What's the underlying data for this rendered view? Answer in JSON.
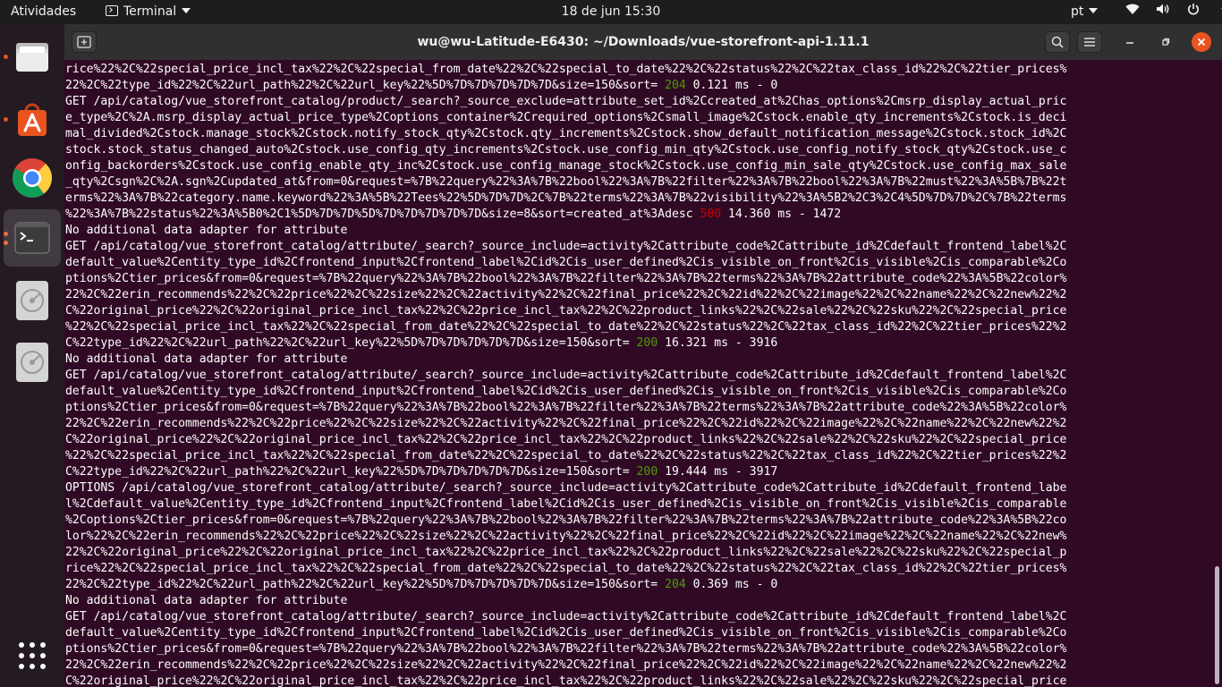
{
  "topbar": {
    "activities": "Atividades",
    "app_name": "Terminal",
    "clock": "18 de jun  15:30",
    "lang": "pt",
    "icons": [
      "wifi-icon",
      "volume-icon",
      "power-icon"
    ]
  },
  "dock": {
    "apps": [
      {
        "name": "files",
        "icon": "folder-icon",
        "running": true
      },
      {
        "name": "software",
        "icon": "shopping-bag-icon",
        "running": true
      },
      {
        "name": "chrome",
        "icon": "chrome-icon",
        "running": false
      },
      {
        "name": "terminal",
        "icon": "terminal-icon",
        "running": true,
        "active": true
      },
      {
        "name": "disc-1",
        "icon": "disc-icon",
        "running": false
      },
      {
        "name": "disc-2",
        "icon": "disc-icon",
        "running": false
      }
    ],
    "show_apps_icon": "grid-icon",
    "colors": {
      "accent": "#e95420"
    }
  },
  "window": {
    "title": "wu@wu-Latitude-E6430: ~/Downloads/vue-storefront-api-1.11.1"
  },
  "terminal": {
    "colors": {
      "bg": "#300a24",
      "fg": "#ffffff",
      "ok": "#4e9a06",
      "err": "#cc0000"
    },
    "lines": [
      {
        "t": "rice%22%2C%22special_price_incl_tax%22%2C%22special_from_date%22%2C%22special_to_date%22%2C%22status%22%2C%22tax_class_id%22%2C%22tier_prices%"
      },
      {
        "t": "22%2C%22type_id%22%2C%22url_path%22%2C%22url_key%22%5D%7D%7D%7D%7D%7D&size=150&sort= ",
        "s": "204",
        "c": "g",
        "r": " 0.121 ms - 0"
      },
      {
        "t": "GET /api/catalog/vue_storefront_catalog/product/_search?_source_exclude=attribute_set_id%2Ccreated_at%2Chas_options%2Cmsrp_display_actual_pric"
      },
      {
        "t": "e_type%2C%2A.msrp_display_actual_price_type%2Coptions_container%2Crequired_options%2Csmall_image%2Cstock.enable_qty_increments%2Cstock.is_deci"
      },
      {
        "t": "mal_divided%2Cstock.manage_stock%2Cstock.notify_stock_qty%2Cstock.qty_increments%2Cstock.show_default_notification_message%2Cstock.stock_id%2C"
      },
      {
        "t": "stock.stock_status_changed_auto%2Cstock.use_config_qty_increments%2Cstock.use_config_min_qty%2Cstock.use_config_notify_stock_qty%2Cstock.use_c"
      },
      {
        "t": "onfig_backorders%2Cstock.use_config_enable_qty_inc%2Cstock.use_config_manage_stock%2Cstock.use_config_min_sale_qty%2Cstock.use_config_max_sale"
      },
      {
        "t": "_qty%2Csgn%2C%2A.sgn%2Cupdated_at&from=0&request=%7B%22query%22%3A%7B%22bool%22%3A%7B%22filter%22%3A%7B%22bool%22%3A%7B%22must%22%3A%5B%7B%22t"
      },
      {
        "t": "erms%22%3A%7B%22category.name.keyword%22%3A%5B%22Tees%22%5D%7D%7D%2C%7B%22terms%22%3A%7B%22visibility%22%3A%5B2%2C3%2C4%5D%7D%7D%2C%7B%22terms"
      },
      {
        "t": "%22%3A%7B%22status%22%3A%5B0%2C1%5D%7D%7D%5D%7D%7D%7D%7D%7D&size=8&sort=created_at%3Adesc ",
        "s": "500",
        "c": "r",
        "r": " 14.360 ms - 1472"
      },
      {
        "t": "No additional data adapter for attribute"
      },
      {
        "t": "GET /api/catalog/vue_storefront_catalog/attribute/_search?_source_include=activity%2Cattribute_code%2Cattribute_id%2Cdefault_frontend_label%2C"
      },
      {
        "t": "default_value%2Centity_type_id%2Cfrontend_input%2Cfrontend_label%2Cid%2Cis_user_defined%2Cis_visible_on_front%2Cis_visible%2Cis_comparable%2Co"
      },
      {
        "t": "ptions%2Ctier_prices&from=0&request=%7B%22query%22%3A%7B%22bool%22%3A%7B%22filter%22%3A%7B%22terms%22%3A%7B%22attribute_code%22%3A%5B%22color%"
      },
      {
        "t": "22%2C%22erin_recommends%22%2C%22price%22%2C%22size%22%2C%22activity%22%2C%22final_price%22%2C%22id%22%2C%22image%22%2C%22name%22%2C%22new%22%2"
      },
      {
        "t": "C%22original_price%22%2C%22original_price_incl_tax%22%2C%22price_incl_tax%22%2C%22product_links%22%2C%22sale%22%2C%22sku%22%2C%22special_price"
      },
      {
        "t": "%22%2C%22special_price_incl_tax%22%2C%22special_from_date%22%2C%22special_to_date%22%2C%22status%22%2C%22tax_class_id%22%2C%22tier_prices%22%2"
      },
      {
        "t": "C%22type_id%22%2C%22url_path%22%2C%22url_key%22%5D%7D%7D%7D%7D%7D&size=150&sort= ",
        "s": "200",
        "c": "g",
        "r": " 16.321 ms - 3916"
      },
      {
        "t": "No additional data adapter for attribute"
      },
      {
        "t": "GET /api/catalog/vue_storefront_catalog/attribute/_search?_source_include=activity%2Cattribute_code%2Cattribute_id%2Cdefault_frontend_label%2C"
      },
      {
        "t": "default_value%2Centity_type_id%2Cfrontend_input%2Cfrontend_label%2Cid%2Cis_user_defined%2Cis_visible_on_front%2Cis_visible%2Cis_comparable%2Co"
      },
      {
        "t": "ptions%2Ctier_prices&from=0&request=%7B%22query%22%3A%7B%22bool%22%3A%7B%22filter%22%3A%7B%22terms%22%3A%7B%22attribute_code%22%3A%5B%22color%"
      },
      {
        "t": "22%2C%22erin_recommends%22%2C%22price%22%2C%22size%22%2C%22activity%22%2C%22final_price%22%2C%22id%22%2C%22image%22%2C%22name%22%2C%22new%22%2"
      },
      {
        "t": "C%22original_price%22%2C%22original_price_incl_tax%22%2C%22price_incl_tax%22%2C%22product_links%22%2C%22sale%22%2C%22sku%22%2C%22special_price"
      },
      {
        "t": "%22%2C%22special_price_incl_tax%22%2C%22special_from_date%22%2C%22special_to_date%22%2C%22status%22%2C%22tax_class_id%22%2C%22tier_prices%22%2"
      },
      {
        "t": "C%22type_id%22%2C%22url_path%22%2C%22url_key%22%5D%7D%7D%7D%7D%7D&size=150&sort= ",
        "s": "200",
        "c": "g",
        "r": " 19.444 ms - 3917"
      },
      {
        "t": "OPTIONS /api/catalog/vue_storefront_catalog/attribute/_search?_source_include=activity%2Cattribute_code%2Cattribute_id%2Cdefault_frontend_labe"
      },
      {
        "t": "l%2Cdefault_value%2Centity_type_id%2Cfrontend_input%2Cfrontend_label%2Cid%2Cis_user_defined%2Cis_visible_on_front%2Cis_visible%2Cis_comparable"
      },
      {
        "t": "%2Coptions%2Ctier_prices&from=0&request=%7B%22query%22%3A%7B%22bool%22%3A%7B%22filter%22%3A%7B%22terms%22%3A%7B%22attribute_code%22%3A%5B%22co"
      },
      {
        "t": "lor%22%2C%22erin_recommends%22%2C%22price%22%2C%22size%22%2C%22activity%22%2C%22final_price%22%2C%22id%22%2C%22image%22%2C%22name%22%2C%22new%"
      },
      {
        "t": "22%2C%22original_price%22%2C%22original_price_incl_tax%22%2C%22price_incl_tax%22%2C%22product_links%22%2C%22sale%22%2C%22sku%22%2C%22special_p"
      },
      {
        "t": "rice%22%2C%22special_price_incl_tax%22%2C%22special_from_date%22%2C%22special_to_date%22%2C%22status%22%2C%22tax_class_id%22%2C%22tier_prices%"
      },
      {
        "t": "22%2C%22type_id%22%2C%22url_path%22%2C%22url_key%22%5D%7D%7D%7D%7D%7D&size=150&sort= ",
        "s": "204",
        "c": "g",
        "r": " 0.369 ms - 0"
      },
      {
        "t": "No additional data adapter for attribute"
      },
      {
        "t": "GET /api/catalog/vue_storefront_catalog/attribute/_search?_source_include=activity%2Cattribute_code%2Cattribute_id%2Cdefault_frontend_label%2C"
      },
      {
        "t": "default_value%2Centity_type_id%2Cfrontend_input%2Cfrontend_label%2Cid%2Cis_user_defined%2Cis_visible_on_front%2Cis_visible%2Cis_comparable%2Co"
      },
      {
        "t": "ptions%2Ctier_prices&from=0&request=%7B%22query%22%3A%7B%22bool%22%3A%7B%22filter%22%3A%7B%22terms%22%3A%7B%22attribute_code%22%3A%5B%22color%"
      },
      {
        "t": "22%2C%22erin_recommends%22%2C%22price%22%2C%22size%22%2C%22activity%22%2C%22final_price%22%2C%22id%22%2C%22image%22%2C%22name%22%2C%22new%22%2"
      },
      {
        "t": "C%22original_price%22%2C%22original_price_incl_tax%22%2C%22price_incl_tax%22%2C%22product_links%22%2C%22sale%22%2C%22sku%22%2C%22special_price"
      }
    ]
  }
}
